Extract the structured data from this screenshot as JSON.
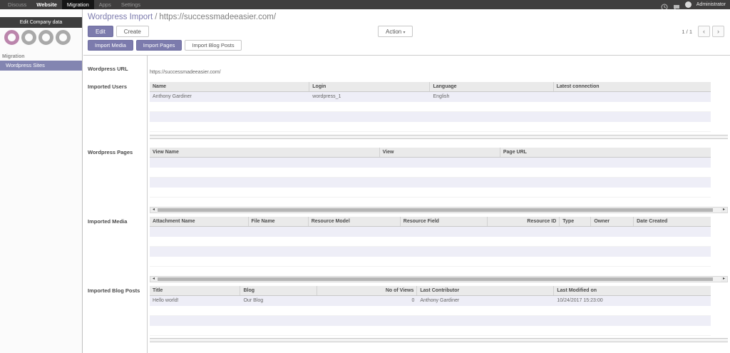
{
  "topbar": {
    "menus": [
      {
        "label": "Discuss"
      },
      {
        "label": "Website"
      },
      {
        "label": "Migration",
        "active": true
      },
      {
        "label": "Apps"
      },
      {
        "label": "Settings"
      }
    ],
    "user": "Administrator"
  },
  "sidebar": {
    "edit_company_label": "Edit Company data",
    "section": "Migration",
    "items": [
      {
        "label": "Wordpress Sites",
        "selected": true
      }
    ]
  },
  "header": {
    "breadcrumb": [
      {
        "label": "Wordpress Import"
      },
      {
        "label": "https://successmadeeasier.com/"
      }
    ],
    "buttons": {
      "edit": "Edit",
      "create": "Create",
      "action": "Action"
    },
    "pager": {
      "text": "1 / 1"
    }
  },
  "smart_buttons": [
    {
      "label": "Import Media"
    },
    {
      "label": "Import Pages"
    },
    {
      "label": "Import Blog Posts"
    }
  ],
  "form": {
    "wordpress_url": {
      "label": "Wordpress URL",
      "value": "https://successmadeeasier.com/"
    },
    "imported_users": {
      "label": "Imported Users",
      "columns": [
        "Name",
        "Login",
        "Language",
        "Latest connection"
      ],
      "widths": [
        28.5,
        21.5,
        22,
        28
      ],
      "aligns": [
        "left",
        "left",
        "left",
        "left"
      ],
      "rows": [
        [
          "Anthony Gardiner",
          "wordpress_1",
          "English",
          ""
        ]
      ],
      "empty_rows": 3
    },
    "wordpress_pages": {
      "label": "Wordpress Pages",
      "columns": [
        "View Name",
        "View",
        "Page URL"
      ],
      "widths": [
        41,
        21.5,
        37.5
      ],
      "aligns": [
        "left",
        "left",
        "left"
      ],
      "rows": [],
      "empty_rows": 4
    },
    "imported_media": {
      "label": "Imported Media",
      "columns": [
        "Attachment Name",
        "File Name",
        "Resource Model",
        "Resource Field",
        "Resource ID",
        "Type",
        "Owner",
        "Date Created"
      ],
      "widths": [
        17.6,
        10.7,
        16.4,
        15.5,
        12.9,
        5.6,
        7.6,
        13.7
      ],
      "aligns": [
        "left",
        "left",
        "left",
        "left",
        "right",
        "left",
        "left",
        "left"
      ],
      "rows": [],
      "empty_rows": 4
    },
    "imported_blog_posts": {
      "label": "Imported Blog Posts",
      "columns": [
        "Title",
        "Blog",
        "No of Views",
        "Last Contributor",
        "Last Modified on"
      ],
      "widths": [
        16.2,
        13.7,
        17.8,
        24.4,
        27.9
      ],
      "aligns": [
        "left",
        "left",
        "right",
        "left",
        "left"
      ],
      "rows": [
        [
          "Hello world!",
          "Our Blog",
          "0",
          "Anthony Gardiner",
          "10/24/2017 15:23:00"
        ]
      ],
      "empty_rows": 3
    }
  },
  "colors": {
    "accent": "#7c7bad",
    "topbar_bg": "#3f3e3e",
    "selected_item_bg": "#8385b1",
    "row_stripe": "#eeeef7",
    "logo_pink": "#bb85ac"
  }
}
